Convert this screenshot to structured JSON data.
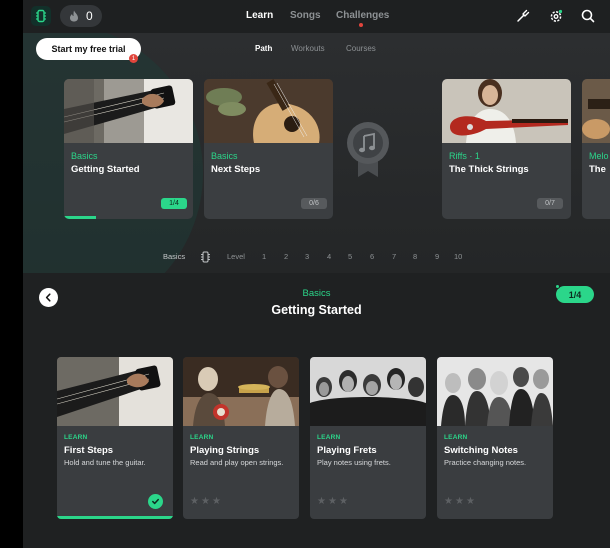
{
  "topbar": {
    "streak_count": "0",
    "tabs": [
      {
        "label": "Learn",
        "active": true
      },
      {
        "label": "Songs",
        "active": false
      },
      {
        "label": "Challenges",
        "active": false
      }
    ],
    "icons": [
      "app-logo-icon",
      "flame-icon",
      "tuning-fork-icon",
      "settings-gear-icon",
      "search-icon"
    ],
    "accent_color": "#2bd68a",
    "notification_color": "#e1453c"
  },
  "hero": {
    "trial_button": "Start my free trial",
    "trial_badge": "1",
    "sub_tabs": [
      {
        "label": "Path",
        "active": true
      },
      {
        "label": "Workouts",
        "active": false
      },
      {
        "label": "Courses",
        "active": false
      }
    ],
    "path_cards": [
      {
        "category": "Basics",
        "title": "Getting Started",
        "progress": "1/4",
        "active": true
      },
      {
        "category": "Basics",
        "title": "Next Steps",
        "progress": "0/6",
        "active": false
      },
      {
        "category": "Riffs · 1",
        "title": "The Thick Strings",
        "progress": "0/7",
        "active": false
      },
      {
        "category": "Melo",
        "title": "The",
        "progress": "",
        "active": false
      }
    ],
    "milestone_icon": "music-note-medal-icon",
    "level_row": {
      "name": "Basics",
      "level_label": "Level",
      "levels": [
        "1",
        "2",
        "3",
        "4",
        "5",
        "6",
        "7",
        "8",
        "9",
        "10"
      ]
    }
  },
  "lower": {
    "category": "Basics",
    "title": "Getting Started",
    "progress": "1/4",
    "lessons": [
      {
        "tag": "LEARN",
        "name": "First Steps",
        "desc": "Hold and tune the guitar.",
        "completed": true
      },
      {
        "tag": "LEARN",
        "name": "Playing Strings",
        "desc": "Read and play open strings.",
        "completed": false
      },
      {
        "tag": "LEARN",
        "name": "Playing Frets",
        "desc": "Play notes using frets.",
        "completed": false
      },
      {
        "tag": "LEARN",
        "name": "Switching Notes",
        "desc": "Practice changing notes.",
        "completed": false
      }
    ]
  }
}
